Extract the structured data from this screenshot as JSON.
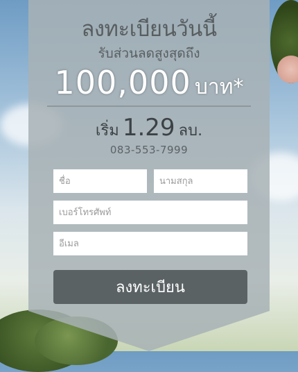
{
  "promo": {
    "title": "ลงทะเบียนวันนี้",
    "subtitle": "รับส่วนลดสูงสุดถึง",
    "amount": "100,000",
    "amount_unit": "บาท*",
    "start_label": "เริ่ม",
    "start_price": "1.29",
    "start_unit": "ลบ.",
    "phone": "083-553-7999"
  },
  "form": {
    "first_name_placeholder": "ชื่อ",
    "last_name_placeholder": "นามสกุล",
    "phone_placeholder": "เบอร์โทรศัพท์",
    "email_placeholder": "อีเมล",
    "submit_label": "ลงทะเบียน"
  },
  "colors": {
    "panel": "#a8b2b5",
    "button": "#5b6264",
    "text_dark": "#585e60"
  }
}
